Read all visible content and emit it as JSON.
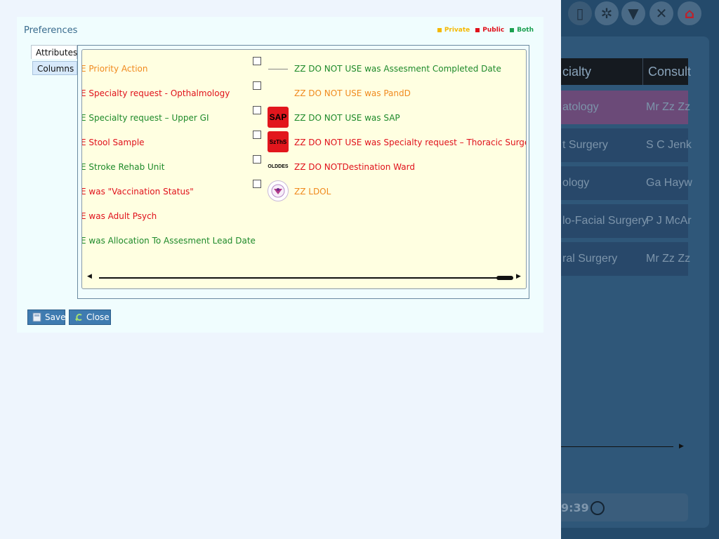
{
  "background_app": {
    "header": {
      "col1": "cialty",
      "col2": "Consult"
    },
    "rows": [
      {
        "c1": "atology",
        "c2": "Mr Zz Zz"
      },
      {
        "c1": "t Surgery",
        "c2": "S C Jenk"
      },
      {
        "c1": "ology",
        "c2": "Ga Hayw"
      },
      {
        "c1": "lo-Facial Surgery",
        "c2": "P J McAr"
      },
      {
        "c1": "ral Surgery",
        "c2": "Mr Zz Zz"
      }
    ],
    "status_time": "9:39"
  },
  "dialog": {
    "title": "Preferences",
    "legend": [
      {
        "label": "Private",
        "color": "#f5b800"
      },
      {
        "label": "Public",
        "color": "#e0111b"
      },
      {
        "label": "Both",
        "color": "#1aa050"
      }
    ],
    "tabs": [
      {
        "label": "Attributes",
        "active": true
      },
      {
        "label": "Columns",
        "active": false
      }
    ],
    "left_items": [
      {
        "text": "E Priority Action",
        "color": "#f08a1e"
      },
      {
        "text": "E Specialty request - Opthalmology",
        "color": "#e0111b"
      },
      {
        "text": "E Specialty request – Upper GI",
        "color": "#1e8a2a"
      },
      {
        "text": "E Stool Sample",
        "color": "#e0111b"
      },
      {
        "text": "E Stroke Rehab Unit",
        "color": "#1e8a2a"
      },
      {
        "text": "E was \"Vaccination Status\"",
        "color": "#e0111b"
      },
      {
        "text": "E was Adult Psych",
        "color": "#e0111b"
      },
      {
        "text": "E was Allocation To Assesment Lead Date",
        "color": "#1e8a2a"
      }
    ],
    "right_items": [
      {
        "text": "ZZ DO NOT USE was Assesment Completed Date",
        "color": "#1e8a2a",
        "icon": "dash-icon"
      },
      {
        "text": "ZZ DO NOT USE was PandD",
        "color": "#f08a1e",
        "icon": "none"
      },
      {
        "text": "ZZ DO NOT USE was SAP",
        "color": "#1e8a2a",
        "icon": "sap-icon",
        "icon_text": "SAP"
      },
      {
        "text": "ZZ DO NOT USE was Specialty request – Thoracic Surgery",
        "color": "#e0111b",
        "icon": "szths-icon",
        "icon_text": "SzThS"
      },
      {
        "text": "ZZ DO NOTDestination Ward",
        "color": "#e0111b",
        "icon": "oldde-icon",
        "icon_text": "OLDDES"
      },
      {
        "text": "ZZ LDOL",
        "color": "#f08a1e",
        "icon": "logo-icon"
      }
    ],
    "buttons": {
      "save": "Save",
      "close": "Close"
    }
  }
}
